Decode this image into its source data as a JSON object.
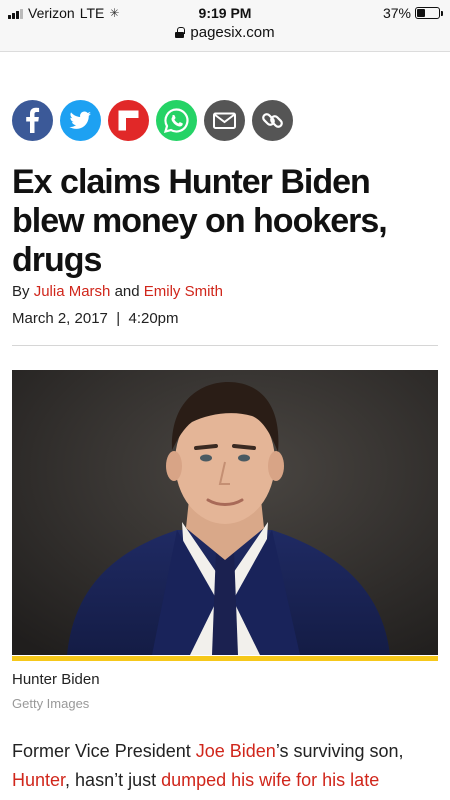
{
  "status": {
    "carrier": "Verizon",
    "network": "LTE",
    "time": "9:19 PM",
    "battery_text": "37%",
    "battery_level": 0.37
  },
  "browser": {
    "url": "pagesix.com"
  },
  "share": {
    "icons": [
      "facebook-icon",
      "twitter-icon",
      "flipboard-icon",
      "whatsapp-icon",
      "email-icon",
      "link-icon"
    ],
    "colors": {
      "facebook": "#3b5998",
      "twitter": "#1da1f2",
      "flipboard": "#e12828",
      "whatsapp": "#25d366",
      "email": "#555555",
      "link": "#555555"
    }
  },
  "article": {
    "headline": "Ex claims Hunter Biden blew money on hookers, drugs",
    "by_prefix": "By",
    "author1": "Julia Marsh",
    "and_word": "and",
    "author2": "Emily Smith",
    "date": "March 2, 2017",
    "separator": "|",
    "time": "4:20pm",
    "photo_caption": "Hunter Biden",
    "photo_credit": "Getty Images",
    "body": {
      "t1": "Former Vice President ",
      "link1": "Joe Biden",
      "t2": "’s surviving son, ",
      "link2": "Hunter",
      "t3": ", hasn’t just ",
      "link3": "dumped his wife for his late"
    }
  },
  "colors": {
    "accent": "#d0261b",
    "photo_bar": "#f6c81a"
  }
}
